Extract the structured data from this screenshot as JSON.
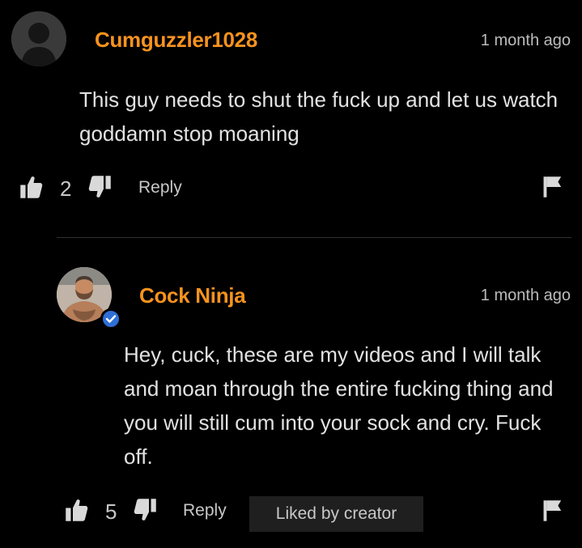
{
  "comment": {
    "username": "Cumguzzler1028",
    "timestamp": "1 month ago",
    "text": "This guy needs to shut the fuck up and let us watch goddamn stop moaning",
    "likes": "2",
    "reply_label": "Reply"
  },
  "reply": {
    "username": "Cock Ninja",
    "timestamp": "1 month ago",
    "text": "Hey, cuck, these are my videos and I will talk and moan through the entire fucking thing and you will still cum into your sock and cry. Fuck off.",
    "likes": "5",
    "reply_label": "Reply",
    "badge": "Liked by creator",
    "verified": true
  },
  "colors": {
    "username": "#f7931e",
    "background": "#000000",
    "verified": "#2f6fd6"
  },
  "icons": [
    "default-avatar-icon",
    "thumbs-up-icon",
    "thumbs-down-icon",
    "flag-icon",
    "verified-check-icon"
  ]
}
